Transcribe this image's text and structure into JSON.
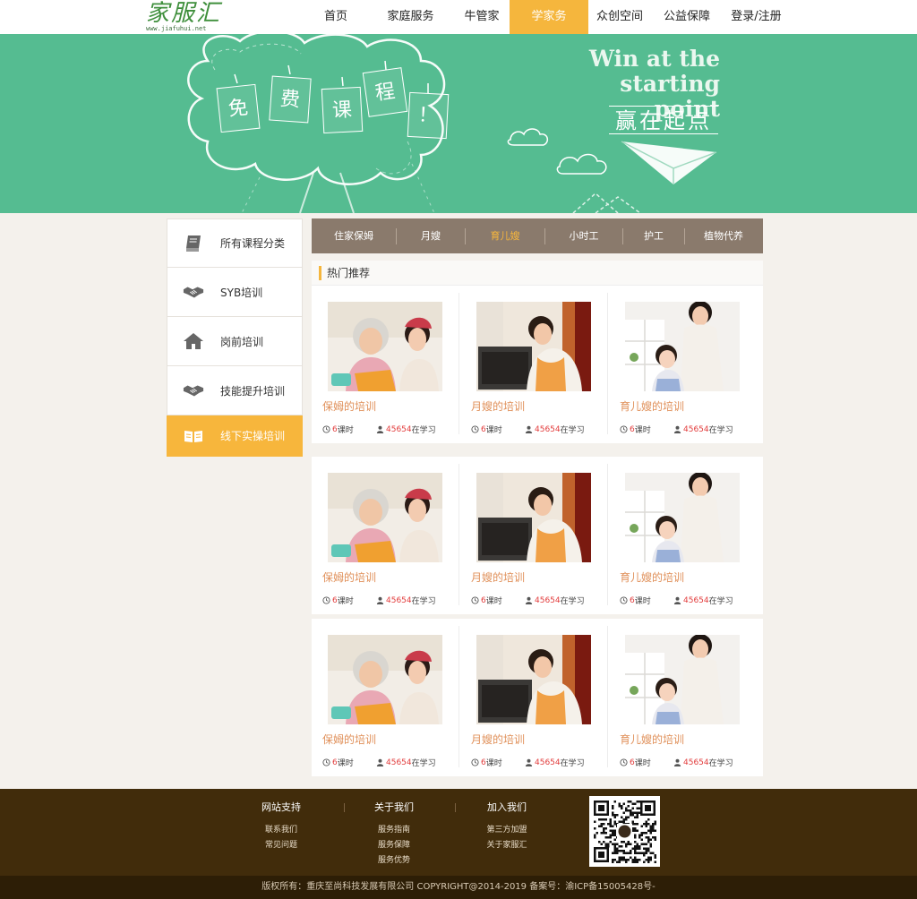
{
  "header": {
    "logo_text": "家服汇",
    "logo_url": "www.jiafuhui.net",
    "nav": [
      {
        "label": "首页",
        "active": false
      },
      {
        "label": "家庭服务",
        "active": false
      },
      {
        "label": "牛管家",
        "active": false
      },
      {
        "label": "学家务",
        "active": true
      },
      {
        "label": "众创空间",
        "active": false
      },
      {
        "label": "公益保障",
        "active": false
      },
      {
        "label": "登录/注册",
        "active": false
      }
    ]
  },
  "banner": {
    "cards": [
      "免",
      "费",
      "课",
      "程",
      "！"
    ],
    "slogan_en": "Win at the starting point",
    "slogan_cn": "赢在起点"
  },
  "sidebar": {
    "items": [
      {
        "label": "所有课程分类",
        "icon": "book-icon",
        "active": false
      },
      {
        "label": "SYB培训",
        "icon": "handshake-icon",
        "active": false
      },
      {
        "label": "岗前培训",
        "icon": "home-icon",
        "active": false
      },
      {
        "label": "技能提升培训",
        "icon": "handshake-icon",
        "active": false
      },
      {
        "label": "线下实操培训",
        "icon": "open-book-icon",
        "active": true
      }
    ]
  },
  "tabs": [
    {
      "label": "住家保姆",
      "active": false
    },
    {
      "label": "月嫂",
      "active": false
    },
    {
      "label": "育儿嫂",
      "active": true
    },
    {
      "label": "小时工",
      "active": false
    },
    {
      "label": "护工",
      "active": false
    },
    {
      "label": "植物代养",
      "active": false
    }
  ],
  "recommend": {
    "title": "热门推荐"
  },
  "courses": [
    [
      {
        "name": "保姆的培训",
        "lessons": "6",
        "lessons_unit": "课时",
        "learners": "45654",
        "learners_unit": "在学习",
        "image": "grandma-caregiver"
      },
      {
        "name": "月嫂的培训",
        "lessons": "6",
        "lessons_unit": "课时",
        "learners": "45654",
        "learners_unit": "在学习",
        "image": "woman-oven"
      },
      {
        "name": "育儿嫂的培训",
        "lessons": "6",
        "lessons_unit": "课时",
        "learners": "45654",
        "learners_unit": "在学习",
        "image": "mother-child"
      }
    ],
    [
      {
        "name": "保姆的培训",
        "lessons": "6",
        "lessons_unit": "课时",
        "learners": "45654",
        "learners_unit": "在学习",
        "image": "grandma-caregiver"
      },
      {
        "name": "月嫂的培训",
        "lessons": "6",
        "lessons_unit": "课时",
        "learners": "45654",
        "learners_unit": "在学习",
        "image": "woman-oven"
      },
      {
        "name": "育儿嫂的培训",
        "lessons": "6",
        "lessons_unit": "课时",
        "learners": "45654",
        "learners_unit": "在学习",
        "image": "mother-child"
      }
    ],
    [
      {
        "name": "保姆的培训",
        "lessons": "6",
        "lessons_unit": "课时",
        "learners": "45654",
        "learners_unit": "在学习",
        "image": "grandma-caregiver"
      },
      {
        "name": "月嫂的培训",
        "lessons": "6",
        "lessons_unit": "课时",
        "learners": "45654",
        "learners_unit": "在学习",
        "image": "woman-oven"
      },
      {
        "name": "育儿嫂的培训",
        "lessons": "6",
        "lessons_unit": "课时",
        "learners": "45654",
        "learners_unit": "在学习",
        "image": "mother-child"
      }
    ]
  ],
  "footer": {
    "columns": [
      {
        "title": "网站支持",
        "links": [
          "联系我们",
          "常见问题"
        ]
      },
      {
        "title": "关于我们",
        "links": [
          "服务指南",
          "服务保障",
          "服务优势"
        ]
      },
      {
        "title": "加入我们",
        "links": [
          "第三方加盟",
          "关于家服汇"
        ]
      }
    ],
    "copyright": "版权所有：重庆至尚科技发展有限公司 COPYRIGHT@2014-2019 备案号：渝ICP备15005428号-"
  },
  "colors": {
    "accent": "#f5b63d",
    "banner_green": "#55bc91",
    "tab_bar": "#8a7a6c",
    "footer_brown": "#412c0b",
    "course_name": "#e0905a",
    "count_red": "#e23c3c"
  }
}
